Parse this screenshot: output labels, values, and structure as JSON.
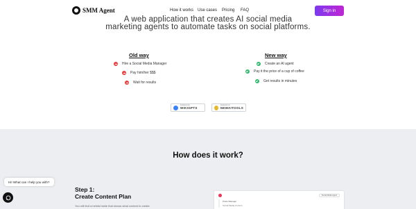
{
  "header": {
    "logo_text": "SMM Agent",
    "nav": [
      "How it works",
      "Use cases",
      "Pricing",
      "FAQ"
    ],
    "signin_label": "Sign in",
    "signin_gradient": [
      "#7c3aed",
      "#c026d3"
    ]
  },
  "hero": {
    "line1": "A web application that creates AI social media",
    "line2": "marketing agents to automate tasks on social platforms."
  },
  "comparison": {
    "old": {
      "title": "Old way",
      "items": [
        "Hire a Social Media Manager",
        "Pay him/her $$$",
        "Wait for results"
      ]
    },
    "new": {
      "title": "New way",
      "items": [
        "Create an AI agent",
        "Pay it the price of a cup of coffee",
        "Get results in minutes"
      ]
    },
    "old_color": "#e84040",
    "new_color": "#2fb86a"
  },
  "badges": [
    {
      "small": "Featured on",
      "big": "WIKIGPTS",
      "icon": "wikigpts-logo-icon",
      "color": "#3b82f6"
    },
    {
      "small": "Featured on",
      "big": "NEWAITOOLS",
      "icon": "newaitools-logo-icon",
      "color": "#e5b92e"
    }
  ],
  "how": {
    "title": "How does it work?",
    "step_label": "Step 1:",
    "step_title": "Create Content Plan",
    "step_text": "You will find a helpful table that shows what content to create"
  },
  "mock": {
    "tag": "Social Media Agent",
    "line1": "Posts Manager",
    "line2": "Social Media Content"
  },
  "chat": {
    "greeting": "Hi! What can I help you with?"
  }
}
